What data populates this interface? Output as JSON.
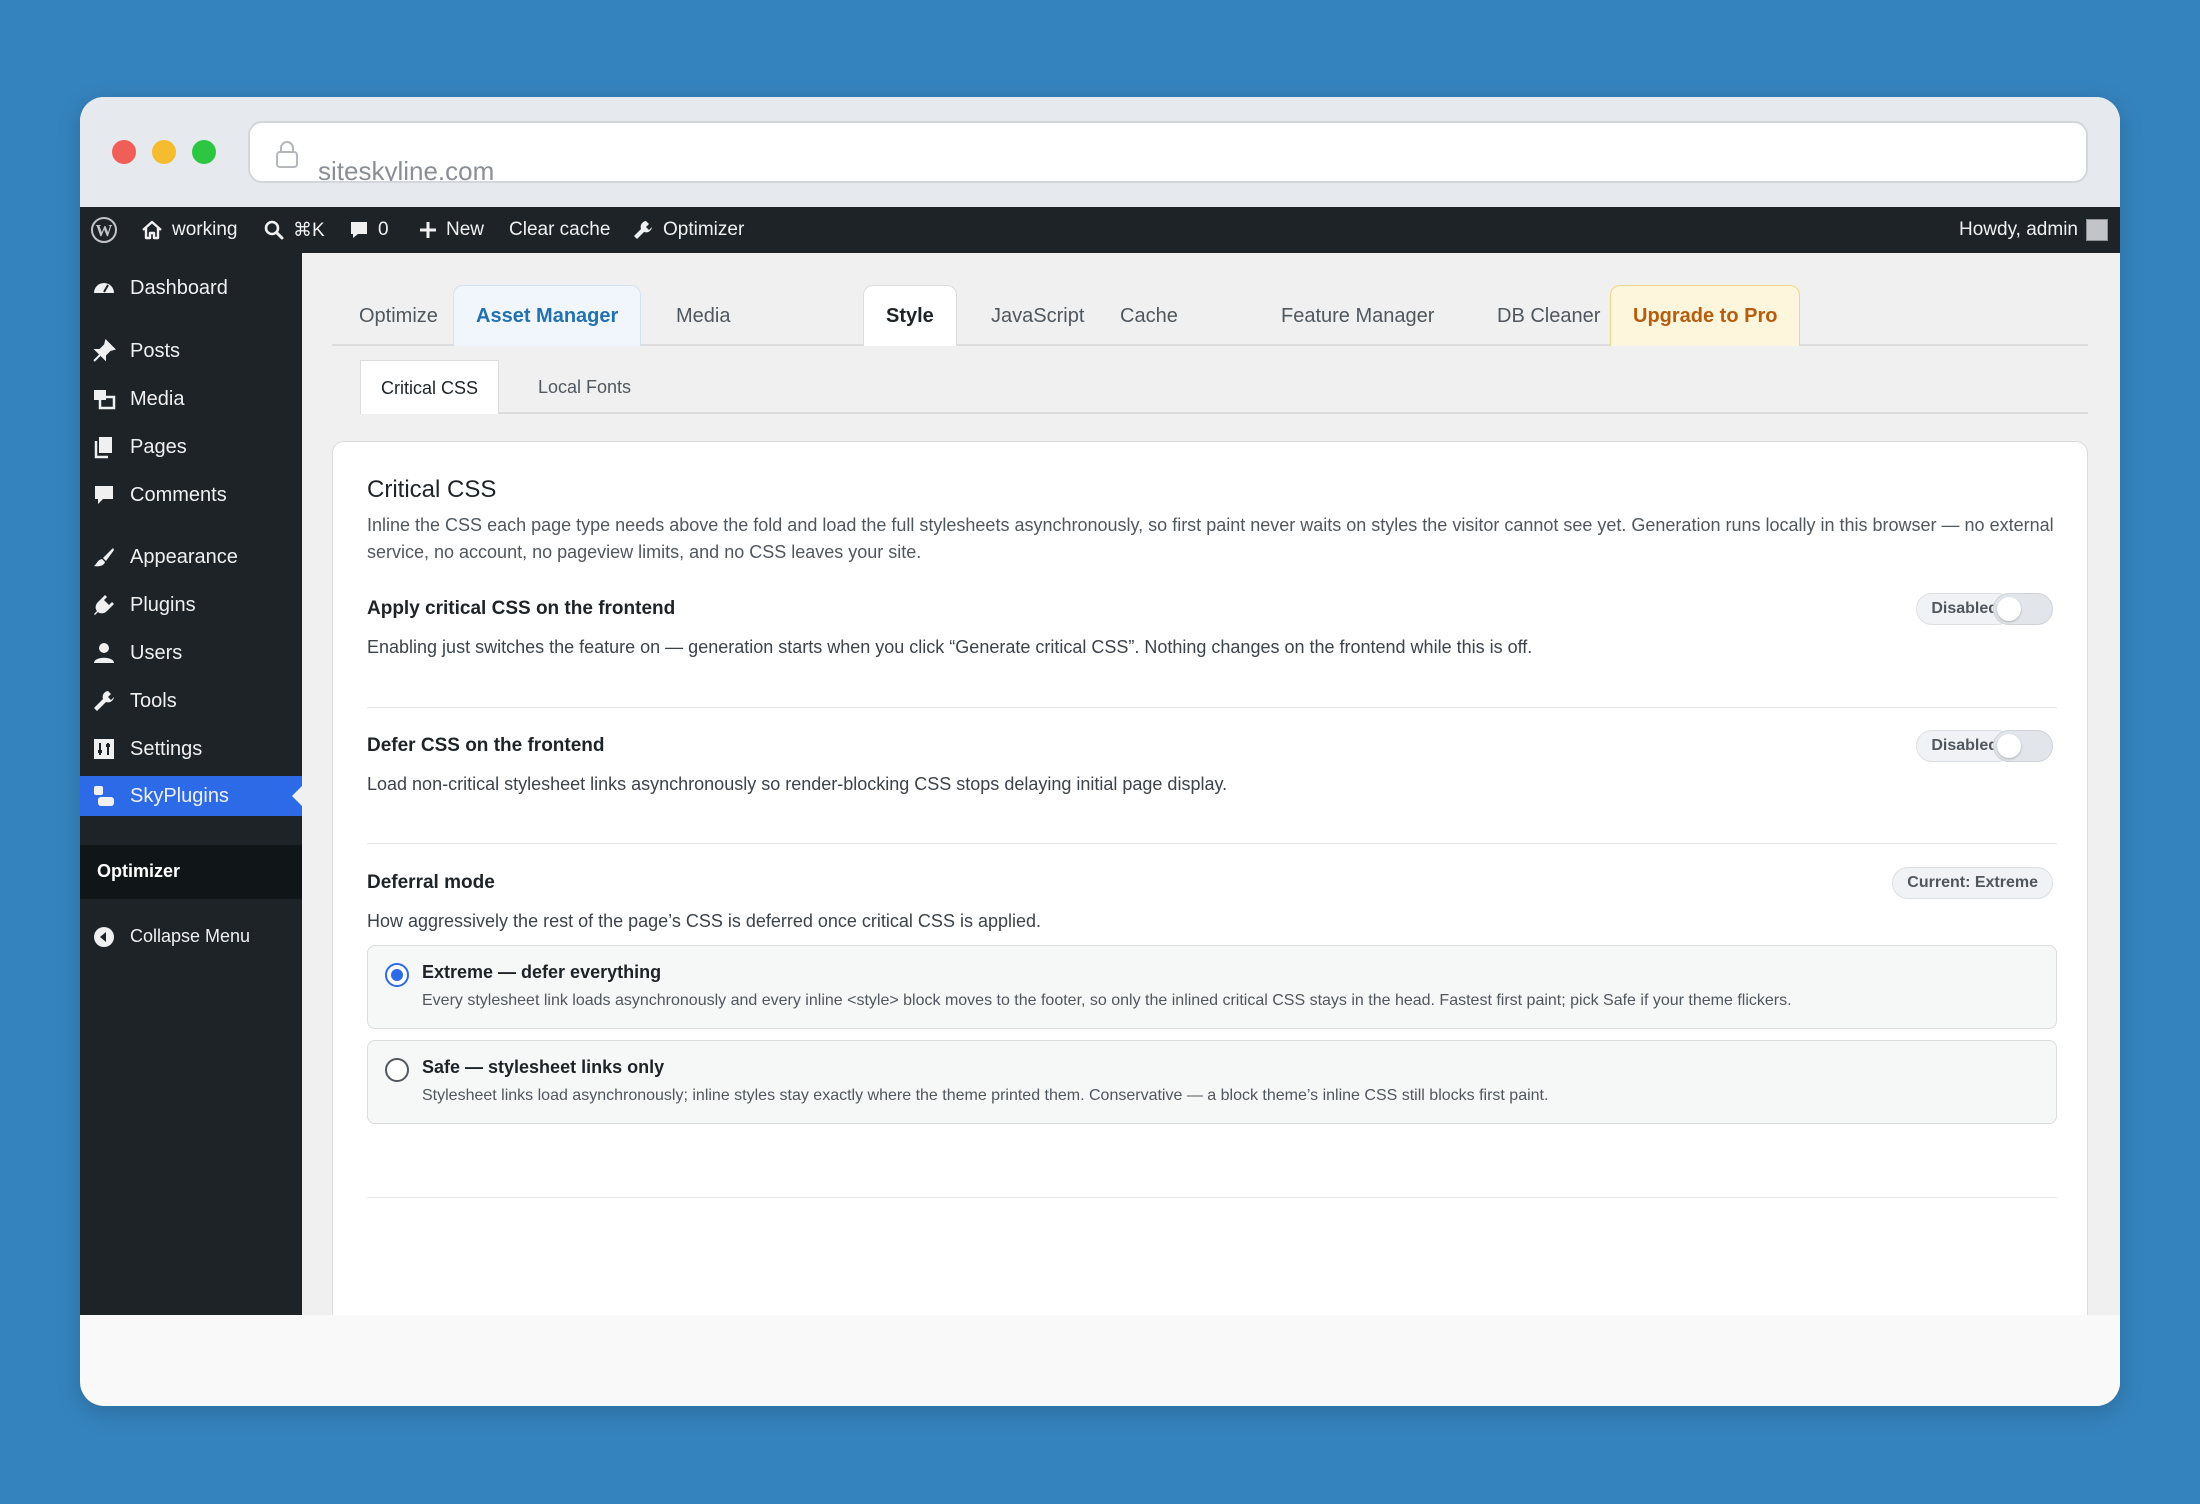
{
  "browser": {
    "url": "siteskyline.com"
  },
  "adminbar": {
    "site_name": "working",
    "search_shortcut": "⌘K",
    "comments_count": "0",
    "new_label": "New",
    "clear_cache_label": "Clear cache",
    "optimizer_label": "Optimizer",
    "howdy": "Howdy, admin"
  },
  "sidebar": {
    "items": [
      {
        "label": "Dashboard",
        "icon": "dashboard-icon"
      },
      {
        "label": "Posts",
        "icon": "pin-icon"
      },
      {
        "label": "Media",
        "icon": "media-icon"
      },
      {
        "label": "Pages",
        "icon": "pages-icon"
      },
      {
        "label": "Comments",
        "icon": "comment-icon"
      },
      {
        "label": "Appearance",
        "icon": "brush-icon"
      },
      {
        "label": "Plugins",
        "icon": "plugin-icon"
      },
      {
        "label": "Users",
        "icon": "user-icon"
      },
      {
        "label": "Tools",
        "icon": "wrench-icon"
      },
      {
        "label": "Settings",
        "icon": "settings-icon"
      },
      {
        "label": "SkyPlugins",
        "icon": "skyplugins-icon"
      }
    ],
    "submenu_label": "Optimizer",
    "collapse_label": "Collapse Menu"
  },
  "tabs": {
    "optimize": "Optimize",
    "asset_manager": "Asset Manager",
    "media": "Media",
    "style": "Style",
    "javascript": "JavaScript",
    "cache": "Cache",
    "feature_manager": "Feature Manager",
    "db_cleaner": "DB Cleaner",
    "upgrade": "Upgrade to Pro"
  },
  "subtabs": {
    "critical_css": "Critical CSS",
    "local_fonts": "Local Fonts"
  },
  "card": {
    "title": "Critical CSS",
    "description": "Inline the CSS each page type needs above the fold and load the full stylesheets asynchronously, so first paint never waits on styles the visitor cannot see yet. Generation runs locally in this browser — no external service, no account, no pageview limits, and no CSS leaves your site.",
    "apply": {
      "title": "Apply critical CSS on the frontend",
      "description": "Enabling just switches the feature on — generation starts when you click “Generate critical CSS”. Nothing changes on the frontend while this is off.",
      "badge": "Disabled",
      "enabled": false
    },
    "defer": {
      "title": "Defer CSS on the frontend",
      "description": "Load non-critical stylesheet links asynchronously so render-blocking CSS stops delaying initial page display.",
      "badge": "Disabled",
      "enabled": false
    },
    "mode": {
      "title": "Deferral mode",
      "badge": "Current: Extreme",
      "description": "How aggressively the rest of the page’s CSS is deferred once critical CSS is applied.",
      "options": [
        {
          "title": "Extreme — defer everything",
          "description": "Every stylesheet link loads asynchronously and every inline <style> block moves to the footer, so only the inlined critical CSS stays in the head. Fastest first paint; pick Safe if your theme flickers.",
          "checked": true
        },
        {
          "title": "Safe — stylesheet links only",
          "description": "Stylesheet links load asynchronously; inline styles stay exactly where the theme printed them. Conservative — a block theme’s inline CSS still blocks first paint.",
          "checked": false
        }
      ]
    }
  },
  "colors": {
    "accent": "#2c6ae8",
    "admin_bg": "#1d2327",
    "pro": "#b75d0e"
  }
}
